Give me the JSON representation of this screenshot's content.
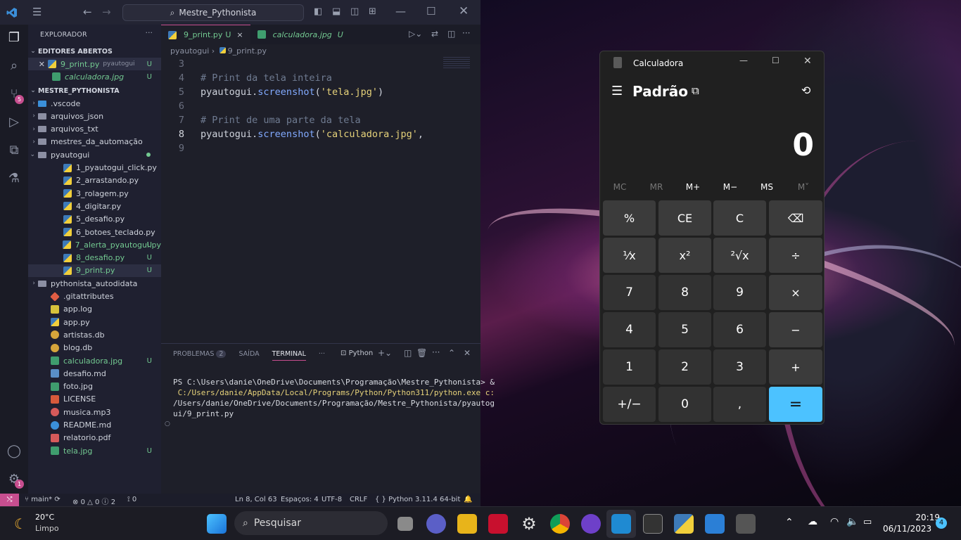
{
  "vscode": {
    "command_center": "Mestre_Pythonista",
    "sidebar_title": "EXPLORADOR",
    "open_editors_label": "EDITORES ABERTOS",
    "open_editors": [
      {
        "name": "9_print.py",
        "folder": "pyautogui",
        "status": "U"
      },
      {
        "name": "calculadora.jpg",
        "status": "U"
      }
    ],
    "workspace_label": "MESTRE_PYTHONISTA",
    "tree": [
      {
        "name": ".vscode",
        "kind": "folder"
      },
      {
        "name": "arquivos_json",
        "kind": "folder"
      },
      {
        "name": "arquivos_txt",
        "kind": "folder"
      },
      {
        "name": "mestres_da_automação",
        "kind": "folder"
      },
      {
        "name": "pyautogui",
        "kind": "folder-open"
      },
      {
        "name": "1_pyautogui_click.py",
        "status": ""
      },
      {
        "name": "2_arrastando.py",
        "status": ""
      },
      {
        "name": "3_rolagem.py",
        "status": ""
      },
      {
        "name": "4_digitar.py",
        "status": ""
      },
      {
        "name": "5_desafio.py",
        "status": ""
      },
      {
        "name": "6_botoes_teclado.py",
        "status": ""
      },
      {
        "name": "7_alerta_pyautogui.py",
        "status": "U"
      },
      {
        "name": "8_desafio.py",
        "status": "U"
      },
      {
        "name": "9_print.py",
        "status": "U"
      },
      {
        "name": "pythonista_autodidata",
        "kind": "folder"
      },
      {
        "name": ".gitattributes",
        "status": ""
      },
      {
        "name": "app.log",
        "status": ""
      },
      {
        "name": "app.py",
        "status": ""
      },
      {
        "name": "artistas.db",
        "status": ""
      },
      {
        "name": "blog.db",
        "status": ""
      },
      {
        "name": "calculadora.jpg",
        "status": "U"
      },
      {
        "name": "desafio.md",
        "status": ""
      },
      {
        "name": "foto.jpg",
        "status": ""
      },
      {
        "name": "LICENSE",
        "status": ""
      },
      {
        "name": "musica.mp3",
        "status": ""
      },
      {
        "name": "README.md",
        "status": ""
      },
      {
        "name": "relatorio.pdf",
        "status": ""
      },
      {
        "name": "tela.jpg",
        "status": "U"
      }
    ],
    "tabs": [
      {
        "name": "9_print.py",
        "status": "U",
        "close": "×"
      },
      {
        "name": "calculadora.jpg",
        "status": "U"
      }
    ],
    "breadcrumb": {
      "folder": "pyautogui",
      "sep": "›",
      "file": "9_print.py"
    },
    "code_lines": [
      {
        "n": "3",
        "text": ""
      },
      {
        "n": "4",
        "comment": "# Print da tela inteira"
      },
      {
        "n": "5",
        "obj": "pyautogui",
        "fn": "screenshot",
        "arg": "'tela.jpg'",
        "tail": ")"
      },
      {
        "n": "6",
        "text": ""
      },
      {
        "n": "7",
        "comment": "# Print de uma parte da tela"
      },
      {
        "n": "8",
        "obj": "pyautogui",
        "fn": "screenshot",
        "arg": "'calculadora.jpg'",
        "tail": ","
      },
      {
        "n": "9",
        "text": ""
      }
    ],
    "panel_tabs": [
      "PROBLEMAS",
      "SAÍDA",
      "TERMINAL"
    ],
    "problems_count": "2",
    "terminal_profile": "Python",
    "terminal_lines": [
      "PS C:\\Users\\danie\\OneDrive\\Documents\\Programação\\Mestre_Pythonista> &",
      " C:/Users/danie/AppData/Local/Programs/Python/Python311/python.exe c:",
      "/Users/danie/OneDrive/Documents/Programação/Mestre_Pythonista/pyautog",
      "ui/9_print.py"
    ],
    "status": {
      "branch": "main*",
      "errors": "0",
      "warnings": "0",
      "info": "2",
      "ports": "0",
      "cursor": "Ln 8, Col 63",
      "spaces": "Espaços: 4",
      "encoding": "UTF-8",
      "eol": "CRLF",
      "language": "Python",
      "interpreter": "3.11.4 64-bit"
    },
    "badges": {
      "scm": "5",
      "settings": "1"
    }
  },
  "calculator": {
    "title": "Calculadora",
    "mode": "Padrão",
    "display": "0",
    "memory": [
      "MC",
      "MR",
      "M+",
      "M−",
      "MS",
      "M˅"
    ],
    "keys": [
      "%",
      "CE",
      "C",
      "⌫",
      "¹⁄x",
      "x²",
      "²√x",
      "÷",
      "7",
      "8",
      "9",
      "×",
      "4",
      "5",
      "6",
      "−",
      "1",
      "2",
      "3",
      "+",
      "+/−",
      "0",
      ",",
      "="
    ]
  },
  "taskbar": {
    "weather_temp": "20°C",
    "weather_desc": "Limpo",
    "search_placeholder": "Pesquisar",
    "time": "20:19",
    "date": "06/11/2023",
    "notifications": "4"
  },
  "colors": {
    "accent": "#c74e8f",
    "git_untracked": "#73c991",
    "calc_equals": "#4cc2ff"
  }
}
